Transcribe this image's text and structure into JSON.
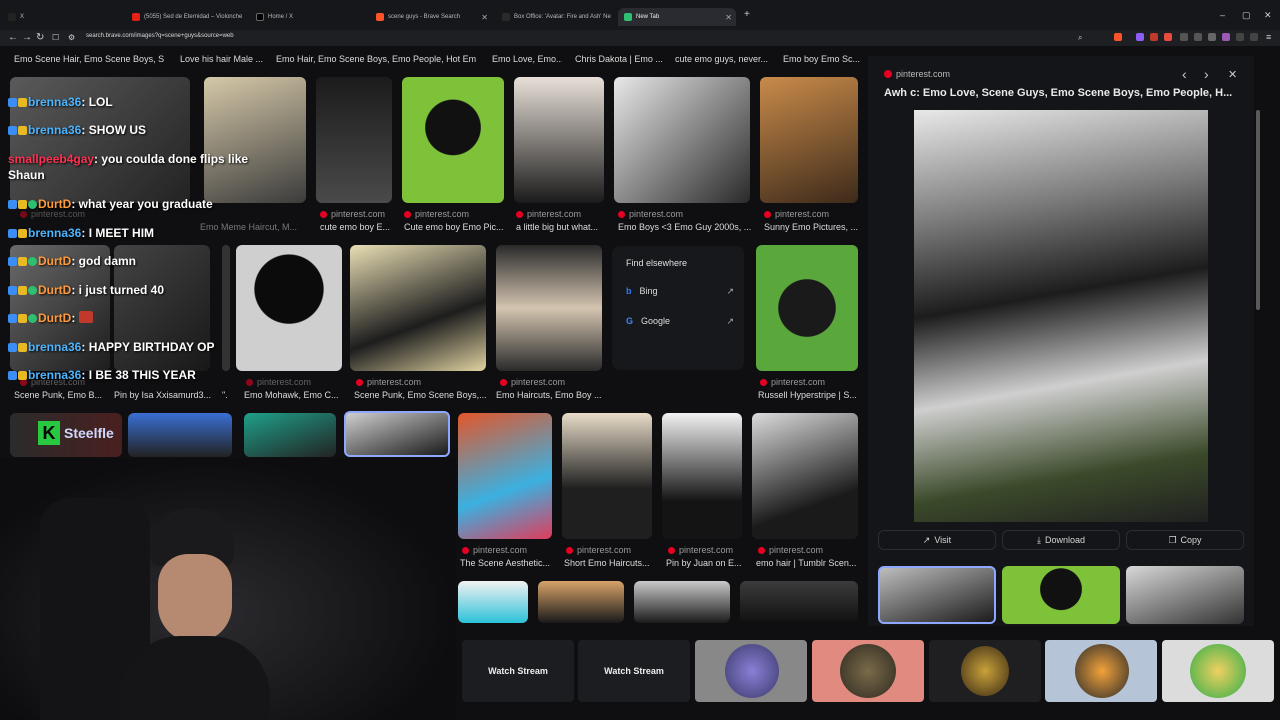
{
  "tabs": [
    {
      "title": "X",
      "active": false
    },
    {
      "title": "(5055) Sed de Eternidad – Violonche",
      "active": false
    },
    {
      "title": "Home / X",
      "active": false
    },
    {
      "title": "scene guys - Brave Search",
      "active": false
    },
    {
      "title": "Box Office: 'Avatar: Fire and Ash' Ne",
      "active": false
    },
    {
      "title": "New Tab",
      "active": true
    }
  ],
  "new_tab": "+",
  "window_controls": {
    "minimize": "–",
    "maximize": "▢",
    "close": "✕"
  },
  "address": "search.brave.com/images?q=scene+guys&source=web",
  "top_captions": [
    "Emo Scene Hair, Emo Scene Boys, S...",
    "Love his hair Male ...",
    "Emo Hair, Emo Scene Boys, Emo People, Hot Em...",
    "Emo Love, Emo...",
    "Chris Dakota | Emo ...",
    "cute emo guys, never...",
    "Emo boy Emo Sc..."
  ],
  "row1": [
    {
      "source": "pinterest.com",
      "caption": "cute emo boy E..."
    },
    {
      "source": "pinterest.com",
      "caption": "Cute emo boy Emo Pic..."
    },
    {
      "source": "pinterest.com",
      "caption": "a little big but what..."
    },
    {
      "source": "pinterest.com",
      "caption": "Emo Boys <3 Emo Guy 2000s, ..."
    },
    {
      "source": "pinterest.com",
      "caption": "Sunny Emo Pictures, ..."
    }
  ],
  "row1_hidden": [
    "pinterest.com",
    "Emo Meme Haircut, M..."
  ],
  "row2": [
    {
      "source": "pinterest.com",
      "caption": "Emo Mohawk, Emo C..."
    },
    {
      "source": "pinterest.com",
      "caption": "Scene Punk, Emo Scene Boys,..."
    },
    {
      "source": "pinterest.com",
      "caption": "Emo Haircuts, Emo Boy ..."
    },
    {
      "source": "pinterest.com",
      "caption": "Russell Hyperstripe | S..."
    }
  ],
  "row2_left": [
    {
      "source": "pinterest.com",
      "caption": "Scene Punk, Emo B..."
    },
    {
      "source": "",
      "caption": "Pin by Isa Xxisamurd3..."
    },
    {
      "source": "",
      "caption": "\"."
    }
  ],
  "find_elsewhere": {
    "title": "Find elsewhere",
    "options": [
      "Bing",
      "Google"
    ]
  },
  "row3": [
    {
      "source": "pinterest.com",
      "caption": "The Scene Aesthetic..."
    },
    {
      "source": "pinterest.com",
      "caption": "Short Emo Haircuts..."
    },
    {
      "source": "pinterest.com",
      "caption": "Pin by Juan on E..."
    },
    {
      "source": "pinterest.com",
      "caption": "emo hair | Tumblr Scen..."
    }
  ],
  "chat": [
    {
      "user": "brenna36",
      "msg": ": LOL",
      "color": "user2"
    },
    {
      "user": "brenna36",
      "msg": ": SHOW US",
      "color": "user2"
    },
    {
      "user": "smallpeeb4gay",
      "msg": ": you coulda done flips like",
      "color": "user3"
    },
    {
      "user": "",
      "msg": "Shaun",
      "color": ""
    },
    {
      "user": "DurtD",
      "msg": ": what year you graduate",
      "color": "user"
    },
    {
      "user": "brenna36",
      "msg": ": I MEET HIM",
      "color": "user2"
    },
    {
      "user": "DurtD",
      "msg": ": god damn",
      "color": "user"
    },
    {
      "user": "DurtD",
      "msg": ": i just turned 40",
      "color": "user"
    },
    {
      "user": "DurtD",
      "msg": ":",
      "color": "user"
    },
    {
      "user": "brenna36",
      "msg": ": HAPPY BIRTHDAY OP",
      "color": "user2"
    },
    {
      "user": "brenna36",
      "msg": ": I BE 38 THIS YEAR",
      "color": "user2"
    }
  ],
  "panel": {
    "source": "pinterest.com",
    "title": "Awh c: Emo Love, Scene Guys, Emo Scene Boys, Emo People, H...",
    "prev": "‹",
    "next": "›",
    "close": "✕",
    "visit": "Visit",
    "download": "Download",
    "copy": "Copy"
  },
  "overlay_logo": "Steelfle",
  "streams": [
    {
      "label": "Watch Stream"
    },
    {
      "label": "Watch Stream"
    }
  ],
  "colors": {
    "accent": "#5b8cff",
    "pinterest": "#e60023",
    "bg": "#0f0f11"
  }
}
